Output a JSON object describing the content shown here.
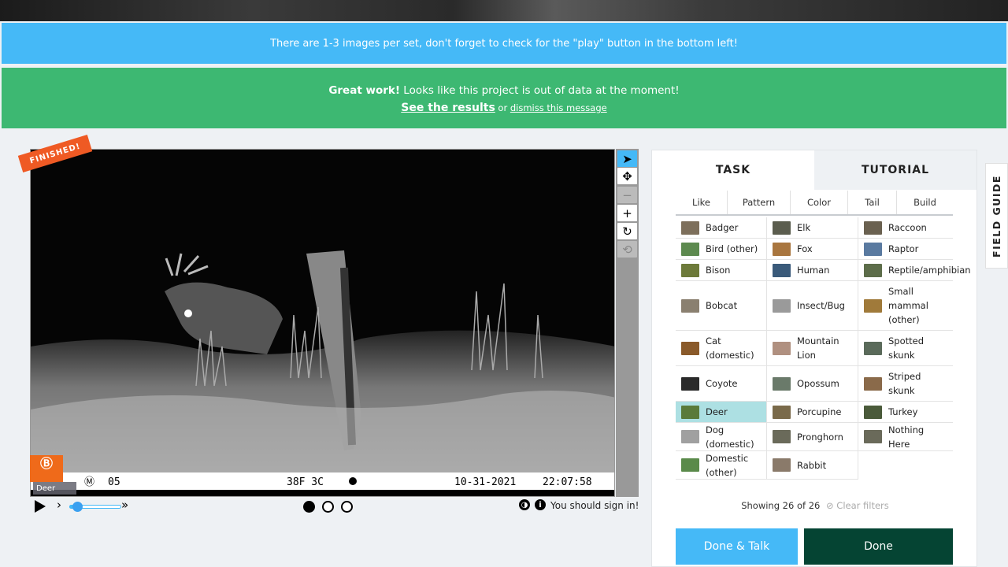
{
  "banners": {
    "info": "There are 1-3 images per set, don't forget to check for the \"play\" button in the bottom left!",
    "success_bold": "Great work!",
    "success_text": " Looks like this project is out of data at the moment!",
    "results_link": "See the results",
    "or_text": " or ",
    "dismiss_link": "dismiss this message"
  },
  "viewer": {
    "finished_label": "FINISHED!",
    "caption_tag": "Deer",
    "camera_strip": {
      "mode": "M",
      "camera_no": "05",
      "temperature": "38F 3C",
      "date": "10-31-2021",
      "time": "22:07:58"
    },
    "brand_logo_text": "Bushnell"
  },
  "toolbar": {
    "icons": [
      "pointer-icon",
      "move-icon",
      "zoom-out-icon",
      "zoom-in-icon",
      "rotate-icon",
      "reset-icon"
    ]
  },
  "controls": {
    "speed_left": "›",
    "speed_right": "»",
    "frames": [
      true,
      false,
      false
    ],
    "contrast_icon": "◑",
    "info_icon": "i",
    "signin_text": "You should sign in!"
  },
  "panel": {
    "tabs": [
      "TASK",
      "TUTORIAL"
    ],
    "filters": [
      "Like",
      "Pattern",
      "Color",
      "Tail",
      "Build"
    ],
    "choices": [
      {
        "label": "Badger",
        "thumb": "#7d6f5b"
      },
      {
        "label": "Elk",
        "thumb": "#5b5d4e"
      },
      {
        "label": "Raccoon",
        "thumb": "#6a6150"
      },
      {
        "label": "Bird (other)",
        "thumb": "#5d8a4f"
      },
      {
        "label": "Fox",
        "thumb": "#a9763f"
      },
      {
        "label": "Raptor",
        "thumb": "#5a7aa0"
      },
      {
        "label": "Bison",
        "thumb": "#6d7a3a"
      },
      {
        "label": "Human",
        "thumb": "#3a5a7a"
      },
      {
        "label": "Reptile/amphibian",
        "thumb": "#5d6d4a"
      },
      {
        "label": "Bobcat",
        "thumb": "#8a8070"
      },
      {
        "label": "Insect/Bug",
        "thumb": "#9a9a9a"
      },
      {
        "label": "Small mammal (other)",
        "thumb": "#a07a3a"
      },
      {
        "label": "Cat (domestic)",
        "thumb": "#8a5a2a"
      },
      {
        "label": "Mountain Lion",
        "thumb": "#b09080"
      },
      {
        "label": "Spotted skunk",
        "thumb": "#5a6a5a"
      },
      {
        "label": "Coyote",
        "thumb": "#2a2a2a"
      },
      {
        "label": "Opossum",
        "thumb": "#6a7a6a"
      },
      {
        "label": "Striped skunk",
        "thumb": "#8a6a4a"
      },
      {
        "label": "Deer",
        "thumb": "#5a7a3a"
      },
      {
        "label": "Porcupine",
        "thumb": "#7a6a4a"
      },
      {
        "label": "Turkey",
        "thumb": "#4a5a3a"
      },
      {
        "label": "Dog (domestic)",
        "thumb": "#a0a0a0"
      },
      {
        "label": "Pronghorn",
        "thumb": "#6a6a5a"
      },
      {
        "label": "Nothing Here",
        "thumb": "#6a6a5a"
      },
      {
        "label": "Domestic (other)",
        "thumb": "#5a8a4a"
      },
      {
        "label": "Rabbit",
        "thumb": "#8a7a6a"
      }
    ],
    "selected": "Deer",
    "showing_text": "Showing 26 of 26",
    "clear_filters": "Clear filters",
    "done_talk": "Done & Talk",
    "done": "Done"
  },
  "field_guide": "FIELD GUIDE",
  "colors": {
    "info_banner": "#45b9f7",
    "success_banner": "#3db872",
    "finished_badge": "#ef5a24",
    "done_button": "#054433",
    "selected_choice": "#ade0e3"
  }
}
